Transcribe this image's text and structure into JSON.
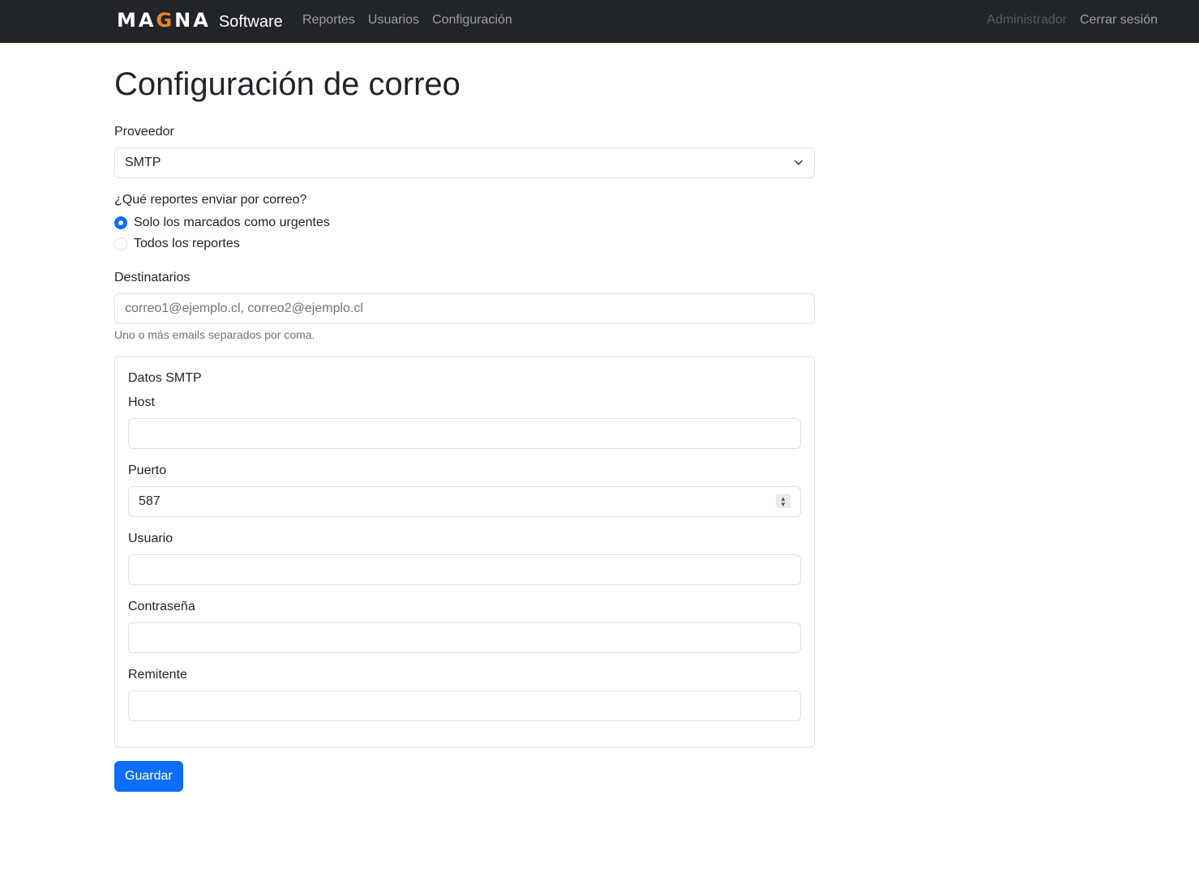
{
  "navbar": {
    "logo_parts": [
      "MA",
      "G",
      "NA"
    ],
    "brand_sub": "Software",
    "links": [
      "Reportes",
      "Usuarios",
      "Configuración"
    ],
    "user": "Administrador",
    "logout": "Cerrar sesión",
    "accent_color": "#f0822a"
  },
  "page": {
    "title": "Configuración de correo"
  },
  "form": {
    "provider_label": "Proveedor",
    "provider_value": "SMTP",
    "reports_question": "¿Qué reportes enviar por correo?",
    "radio_urgent": "Solo los marcados como urgentes",
    "radio_all": "Todos los reportes",
    "recipients_label": "Destinatarios",
    "recipients_placeholder": "correo1@ejemplo.cl, correo2@ejemplo.cl",
    "recipients_help": "Uno o más emails separados por coma.",
    "smtp": {
      "legend": "Datos SMTP",
      "host_label": "Host",
      "port_label": "Puerto",
      "port_value": "587",
      "user_label": "Usuario",
      "password_label": "Contraseña",
      "sender_label": "Remitente"
    },
    "save_label": "Guardar"
  },
  "colors": {
    "navbar_bg": "#212529",
    "primary": "#0d6efd"
  }
}
